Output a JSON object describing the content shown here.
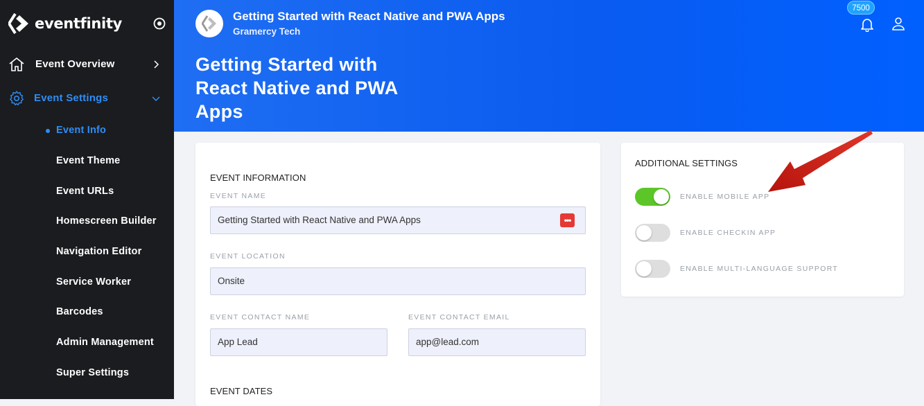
{
  "brand": {
    "name": "eventfinity"
  },
  "sidebar": {
    "top_items": [
      {
        "label": "Event Overview"
      },
      {
        "label": "Event Settings"
      }
    ],
    "sub_items": [
      {
        "label": "Event Info"
      },
      {
        "label": "Event Theme"
      },
      {
        "label": "Event URLs"
      },
      {
        "label": "Homescreen Builder"
      },
      {
        "label": "Navigation Editor"
      },
      {
        "label": "Service Worker"
      },
      {
        "label": "Barcodes"
      },
      {
        "label": "Admin Management"
      },
      {
        "label": "Super Settings"
      }
    ]
  },
  "header": {
    "app_title": "Getting Started with React Native and PWA Apps",
    "org": "Gramercy Tech",
    "page_title": "Getting Started with React Native and PWA Apps",
    "notification_count": "7500"
  },
  "event_info": {
    "section_title": "EVENT INFORMATION",
    "name_label": "EVENT NAME",
    "name_value": "Getting Started with React Native and PWA Apps",
    "location_label": "EVENT LOCATION",
    "location_value": "Onsite",
    "contact_name_label": "EVENT CONTACT NAME",
    "contact_name_value": "App Lead",
    "contact_email_label": "EVENT CONTACT EMAIL",
    "contact_email_value": "app@lead.com",
    "dates_title": "EVENT DATES"
  },
  "additional": {
    "title": "ADDITIONAL SETTINGS",
    "toggles": [
      {
        "label": "ENABLE MOBILE APP",
        "on": true
      },
      {
        "label": "ENABLE CHECKIN APP",
        "on": false
      },
      {
        "label": "ENABLE MULTI-LANGUAGE SUPPORT",
        "on": false
      }
    ]
  },
  "colors": {
    "accent": "#2f8df5",
    "header_blue": "#0a5bf0",
    "toggle_on": "#5cc629",
    "annotation_arrow": "#d42a1f"
  }
}
